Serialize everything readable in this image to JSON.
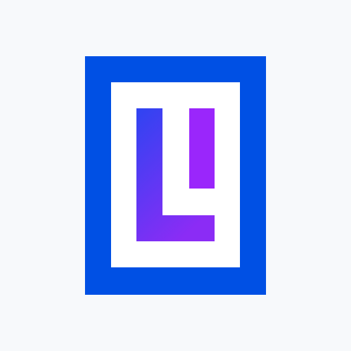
{
  "logo": {
    "icon": "letter-l-i-logo-icon",
    "colors": {
      "background": "#f7f9fb",
      "frame": "#0050e4",
      "inner": "#ffffff",
      "l_top": "#2f44f2",
      "l_bottom": "#8b2cf5",
      "i_bar": "#9a26fb"
    }
  }
}
